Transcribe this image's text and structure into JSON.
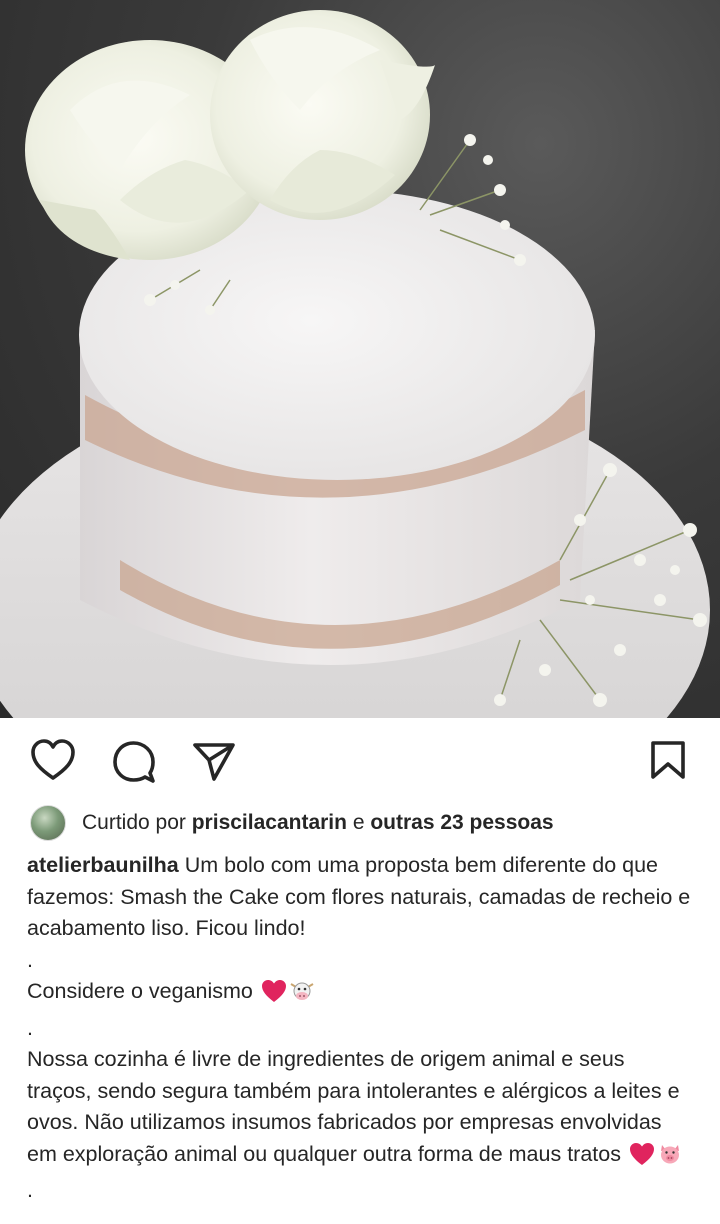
{
  "post": {
    "image_alt": "cake-photo",
    "actions": {
      "like_icon": "heart-icon",
      "comment_icon": "comment-icon",
      "share_icon": "send-icon",
      "save_icon": "bookmark-icon"
    },
    "likes": {
      "prefix": "Curtido por",
      "user": "priscilacantarin",
      "connector": "e",
      "others": "outras 23 pessoas"
    },
    "caption": {
      "username": "atelierbaunilha",
      "text": "Um bolo com uma proposta bem diferente do que fazemos: Smash the Cake com flores naturais, camadas de recheio e acabamento liso. Ficou lindo!",
      "dot1": ".",
      "line2": "Considere o veganismo",
      "dot2": ".",
      "paragraph": "Nossa cozinha é livre de ingredientes de origem animal e seus traços, sendo segura também para intolerantes e alérgicos a leites e ovos. Não utilizamos insumos fabricados por empresas envolvidas em exploração animal ou qualquer outra forma de maus tratos",
      "dot3": "."
    },
    "colors": {
      "text": "#262626",
      "heart_emoji": "#e0245e"
    }
  }
}
